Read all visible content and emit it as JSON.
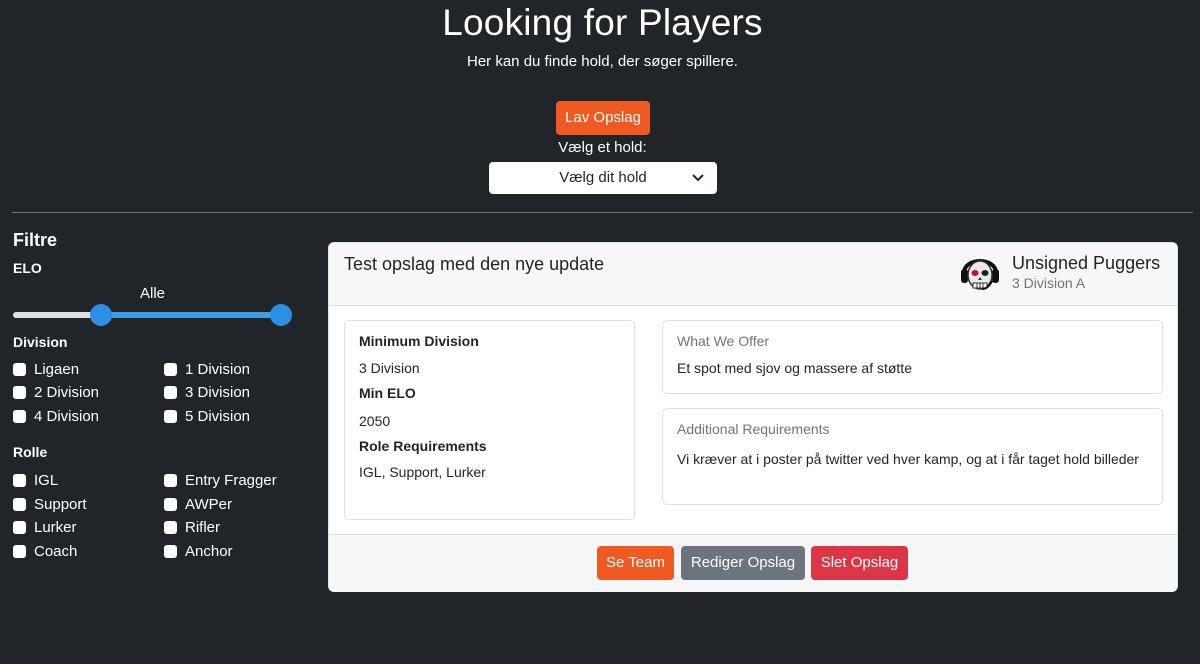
{
  "header": {
    "title": "Looking for Players",
    "subtitle": "Her kan du finde hold, der søger spillere.",
    "create_button": "Lav Opslag",
    "select_label": "Vælg et hold:",
    "select_value": "Vælg dit hold"
  },
  "filters": {
    "heading": "Filtre",
    "elo_label": "ELO",
    "elo_value": "Alle",
    "division_label": "Division",
    "divisions": [
      "Ligaen",
      "1 Division",
      "2 Division",
      "3 Division",
      "4 Division",
      "5 Division"
    ],
    "role_label": "Rolle",
    "roles": [
      "IGL",
      "Entry Fragger",
      "Support",
      "AWPer",
      "Lurker",
      "Rifler",
      "Coach",
      "Anchor"
    ]
  },
  "post": {
    "title": "Test opslag med den nye update",
    "team_name": "Unsigned Puggers",
    "team_division": "3 Division A",
    "min_division_label": "Minimum Division",
    "min_division": "3 Division",
    "min_elo_label": "Min ELO",
    "min_elo": "2050",
    "role_req_label": "Role Requirements",
    "role_req": "IGL, Support, Lurker",
    "offer_label": "What We Offer",
    "offer": "Et spot med sjov og massere af støtte",
    "add_req_label": "Additional Requirements",
    "add_req": "Vi kræver at i poster på twitter ved hver kamp, og at i får taget hold billeder",
    "buttons": {
      "see_team": "Se Team",
      "edit": "Rediger Opslag",
      "delete": "Slet Opslag"
    }
  },
  "colors": {
    "background": "#212529",
    "accent_orange": "#f05a22",
    "slider_blue": "#2d8ee6",
    "danger": "#dc3545",
    "secondary": "#6c757d"
  }
}
